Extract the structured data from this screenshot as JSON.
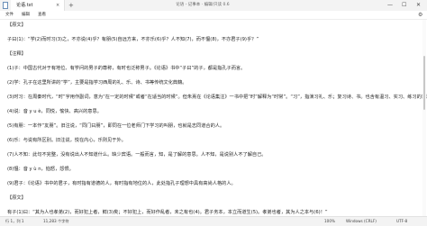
{
  "window": {
    "tab_title": "论语.txt",
    "tab_close": "×",
    "new_tab": "+",
    "center_title": "论语 - 记事本 · 编辑/只读 0.6",
    "minimize": "—",
    "maximize": "☐",
    "close": "✕"
  },
  "menu": {
    "items": [
      "文件",
      "编辑",
      "查看"
    ],
    "settings_icon": "gear-icon",
    "settings_glyph": "⚙"
  },
  "lines": [
    "【原文】",
    "",
    "子曰(1)：“学(2)而时习(3)之，不亦说(4)乎？有朋(5)自远方来，不亦乐(6)乎？人不知(7)，而不愠(8)，不亦君子(9)乎？”",
    "",
    "【注释】",
    "",
    "(1)子：中国古代对于有地位、有学问的男子的尊称，有时也泛称男子。《论语》书中“子曰”的子，都是指孔子而言。",
    "",
    "(2)学：孔子在这里所讲的“学”，主要是指学习西周的礼、乐、诗、书等传统文化典籍。",
    "",
    "(3)时习：在周秦时代，“时”字用作副词，意为“在一定的时候”或者“在适当的时候”。但朱熹在《论语集注》一书中把“时”解释为“时常”。“习”，指演习礼、乐；复习诗、书。也含有温习、实习、练习的意思。",
    "",
    "(4)说：音 y u è，同悦，愉快、高兴的意思。",
    "",
    "(5)有朋：一本作“友朋”。旧注说，“同门曰朋”，即同在一位老师门下学习的叫朋，也就是志同道合的人。",
    "",
    "(6)乐：与说有所区别。旧注说，悦在内心，乐则见于外。",
    "",
    "(7)人不知：此句不完整，没有说出人不知道什么。缺少宾语。一般而言，知，是了解的意思。人不知，是说别人不了解自己。",
    "",
    "(8)愠：音 y ù n，恼怒，怨恨。",
    "",
    "(9)君子：《论语》书中的君子，有时指有道德的人，有时指有地位的人，此处指孔子理想中具有高尚人格的人。",
    "",
    "【原文】",
    "",
    "有子(1)曰：“其为人也孝弟(2)，而好犯上者，鲜(3)矣；不好犯上，而好作乱者，未之有也(4)。君子务本，本立而道生(5)。孝弟也者，其为人之本与(6)！”"
  ],
  "status": {
    "position": "行 1，列 1",
    "chars": "11,283 个字符",
    "zoom": "100%",
    "line_ending": "Windows (CRLF)",
    "encoding": "UTF-8"
  }
}
